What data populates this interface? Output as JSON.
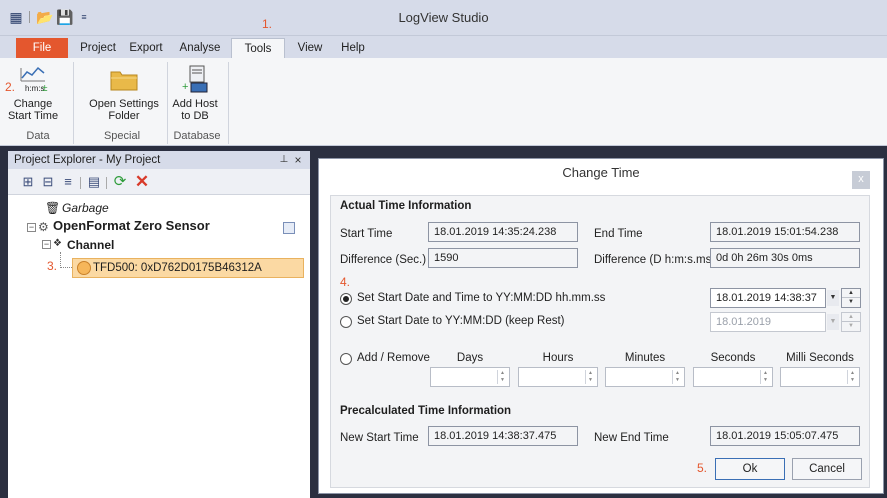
{
  "app": {
    "title": "LogView Studio"
  },
  "annotations": {
    "step1": "1.",
    "step2": "2.",
    "step3": "3.",
    "step4": "4.",
    "step5": "5."
  },
  "menu": {
    "file": "File",
    "project": "Project",
    "export": "Export",
    "analyse": "Analyse",
    "tools": "Tools",
    "view": "View",
    "help": "Help"
  },
  "ribbon": {
    "change_start_time": "Change\nStart Time",
    "change_start_time_l1": "Change",
    "change_start_time_l2": "Start Time",
    "open_settings_l1": "Open Settings",
    "open_settings_l2": "Folder",
    "add_host_l1": "Add Host",
    "add_host_l2": "to DB",
    "group_data": "Data",
    "group_special": "Special",
    "group_database": "Database",
    "icon_text": "h:m:s"
  },
  "project_explorer": {
    "title": "Project Explorer - My Project",
    "pin": "⊥",
    "close": "×",
    "tree": {
      "garbage": "Garbage",
      "sensor": "OpenFormat Zero Sensor",
      "channel": "Channel",
      "selected": "TFD500: 0xD762D0175B46312A"
    }
  },
  "dialog": {
    "title": "Change Time",
    "close": "x",
    "actual": {
      "title": "Actual Time Information",
      "start_time_label": "Start Time",
      "start_time_value": "18.01.2019 14:35:24.238",
      "end_time_label": "End Time",
      "end_time_value": "18.01.2019 15:01:54.238",
      "diff_sec_label": "Difference (Sec.)",
      "diff_sec_value": "1590",
      "diff_dhms_label": "Difference (D h:m:s.ms)",
      "diff_dhms_value": "0d 0h 26m 30s 0ms"
    },
    "options": {
      "opt1_label": "Set Start Date and Time to YY:MM:DD hh.mm.ss",
      "opt1_value": "18.01.2019 14:38:37",
      "opt2_label": "Set Start Date to YY:MM:DD (keep Rest)",
      "opt2_value": "18.01.2019",
      "opt3_label": "Add / Remove",
      "headers": [
        "Days",
        "Hours",
        "Minutes",
        "Seconds",
        "Milli Seconds"
      ]
    },
    "precalc": {
      "title": "Precalculated Time Information",
      "new_start_label": "New Start Time",
      "new_start_value": "18.01.2019 14:38:37.475",
      "new_end_label": "New End Time",
      "new_end_value": "18.01.2019 15:05:07.475"
    },
    "buttons": {
      "ok": "Ok",
      "cancel": "Cancel"
    }
  },
  "colors": {
    "accent_orange": "#e4572e",
    "selection": "#fbd9a3",
    "dark_bg": "#2b2f40",
    "chrome": "#d6dbe9"
  },
  "icons": [
    "quick-access-icon",
    "open-folder-icon",
    "save-icon",
    "dropdown-icon",
    "change-time-icon",
    "folder-icon",
    "add-host-icon",
    "trash-icon",
    "sensor-icon",
    "channel-icon",
    "tfd-node-icon",
    "refresh-icon",
    "delete-icon"
  ]
}
